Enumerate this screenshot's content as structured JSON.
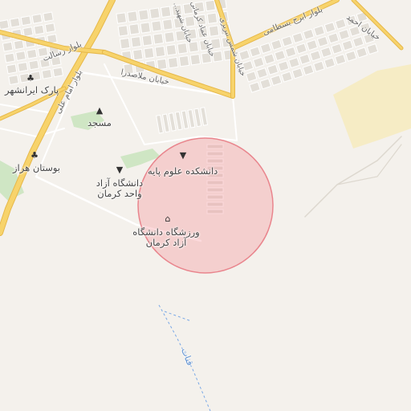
{
  "map": {
    "colors": {
      "background": "#f4f1ec",
      "main_road": "#f7d36b",
      "main_road_casing": "#e6b84a",
      "minor_road": "#ffffff",
      "block": "#e3dfd8",
      "green": "#cfe6c4",
      "sand": "#f6ecc5",
      "circle_fill": "rgba(243,120,130,0.28)",
      "circle_stroke": "#e9858d",
      "water": "#7aa9e6"
    },
    "labels": {
      "blvd_resalat": "بلوار رسالت",
      "street_saham": "خیابان شهید... کرمانی",
      "street_emad": "خیابان عماد کرمانی",
      "street_tabrizi": "خیابان شمس تبریزی",
      "street_mollasadra": "خیابان ملاصدرا",
      "blvd_bastami": "بلوار ابرج بسطامی",
      "street_ahmad": "خیابان احمد",
      "park_iranshahr": "پارک ایرانشهر",
      "blvd_imam_ali": "بلوار امام علی",
      "masjed": "مسجد",
      "bostan_haraz": "بوستان هراز",
      "azad_univ": "دانشگاه آزاد واحد کرمان",
      "faculty_basic_sci": "دانشکده علوم پایه",
      "stadium_azad": "ورزشگاه دانشگاه آزاد کرمان",
      "qanat": "قنات"
    },
    "icons": {
      "park": "tree-icon",
      "mosque": "mosque-icon",
      "bostan": "tree-icon",
      "university": "graduation-cap-icon",
      "faculty": "graduation-cap-icon",
      "stadium": "stadium-icon"
    }
  }
}
